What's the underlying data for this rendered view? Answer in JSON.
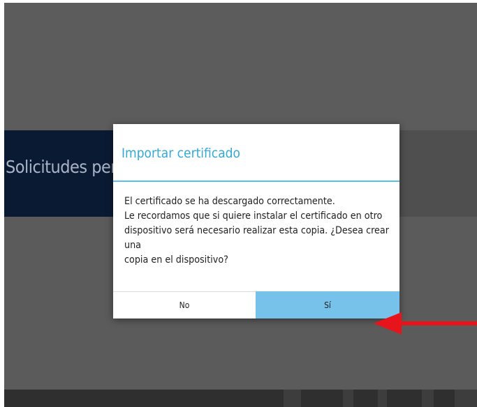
{
  "background_app": {
    "page_title": "Solicitudes pen"
  },
  "dialog": {
    "title": "Importar certificado",
    "message_lines": [
      "El certificado se ha descargado correctamente.",
      "Le recordamos que si quiere instalar el certificado en otro",
      "dispositivo será necesario realizar esta copia. ¿Desea crear una",
      "copia en el dispositivo?"
    ],
    "buttons": {
      "no_label": "No",
      "yes_label": "Sí"
    }
  },
  "annotation": {
    "arrow_icon": "red-arrow-left-icon",
    "arrow_color": "#e8141c"
  },
  "colors": {
    "accent": "#33a9d6",
    "divider": "#5bc0e3",
    "selected_button": "#76c2ea",
    "app_header": "#0b1a33",
    "overlay": "#5c5c5c"
  }
}
